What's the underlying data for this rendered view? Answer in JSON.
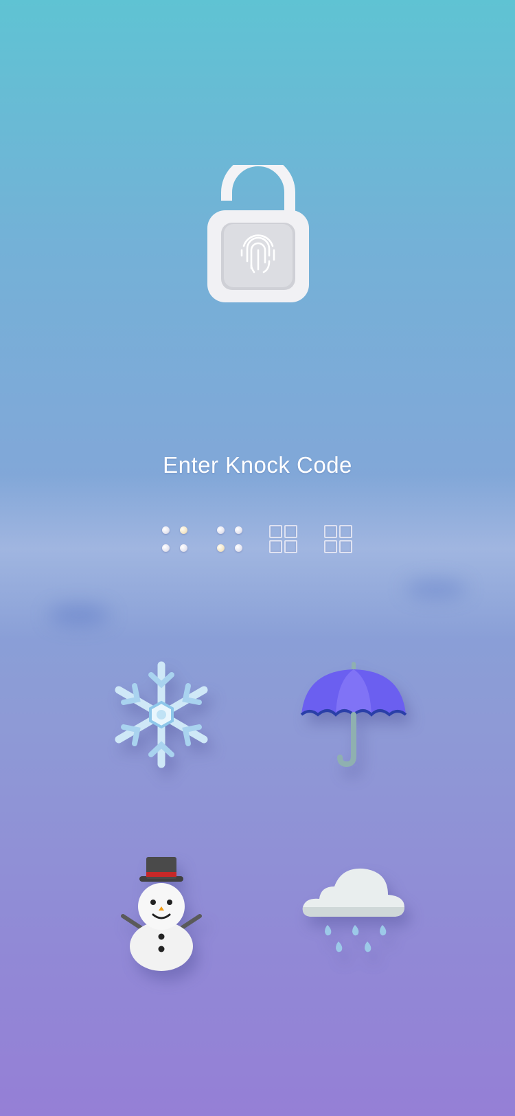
{
  "screen": {
    "title": "Enter Knock Code"
  },
  "lock_icon": {
    "name": "unlocked-padlock-fingerprint-icon",
    "state": "unlocked"
  },
  "progress": {
    "entered": 2,
    "length": 4,
    "slots": [
      {
        "state": "filled",
        "icon": "knock-dots-icon"
      },
      {
        "state": "filled",
        "icon": "knock-dots-icon"
      },
      {
        "state": "empty",
        "icon": "grid-icon"
      },
      {
        "state": "empty",
        "icon": "grid-icon"
      }
    ]
  },
  "knock_pad": {
    "buttons": [
      {
        "name": "snowflake",
        "icon": "snowflake-icon"
      },
      {
        "name": "umbrella",
        "icon": "umbrella-icon"
      },
      {
        "name": "snowman",
        "icon": "snowman-icon"
      },
      {
        "name": "rain-cloud",
        "icon": "rain-cloud-icon"
      }
    ]
  },
  "colors": {
    "gradient_top": "#5fc3d3",
    "gradient_bottom": "#957fd6",
    "text": "#ffffff"
  }
}
